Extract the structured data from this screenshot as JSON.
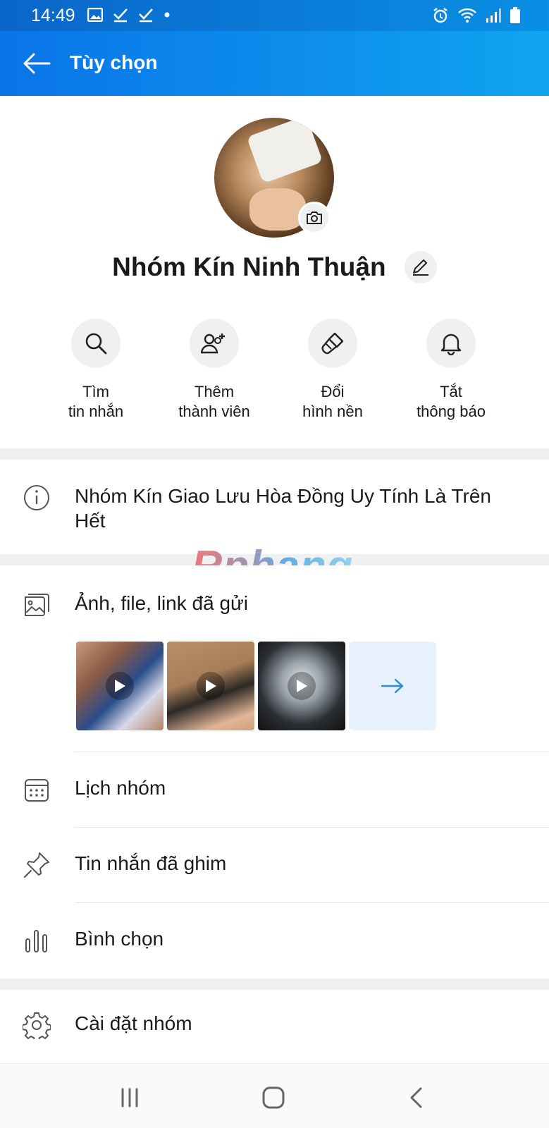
{
  "status_bar": {
    "time": "14:49",
    "left_icons": [
      "image-icon",
      "check-icon",
      "check-icon",
      "dot-icon"
    ],
    "right_icons": [
      "alarm-icon",
      "wifi-icon",
      "signal-icon",
      "battery-icon"
    ]
  },
  "app_bar": {
    "title": "Tùy chọn",
    "back_icon": "arrow-left-icon"
  },
  "profile": {
    "group_name": "Nhóm Kín Ninh Thuận",
    "camera_icon": "camera-icon",
    "edit_icon": "pencil-icon"
  },
  "actions": [
    {
      "icon": "search-icon",
      "label": "Tìm\ntin nhắn"
    },
    {
      "icon": "add-user-icon",
      "label": "Thêm\nthành viên"
    },
    {
      "icon": "brush-icon",
      "label": "Đổi\nhình nền"
    },
    {
      "icon": "bell-icon",
      "label": "Tắt\nthông báo"
    }
  ],
  "description": {
    "icon": "info-icon",
    "text": "Nhóm Kín Giao Lưu Hòa Đồng Uy Tính Là Trên Hết"
  },
  "watermark": "Rphang",
  "media": {
    "icon": "gallery-icon",
    "label": "Ảnh, file, link đã gửi",
    "thumbs": [
      "video-thumbnail",
      "video-thumbnail",
      "video-thumbnail"
    ],
    "more_icon": "arrow-right-icon"
  },
  "menu": [
    {
      "icon": "calendar-icon",
      "label": "Lịch nhóm"
    },
    {
      "icon": "pin-icon",
      "label": "Tin nhắn đã ghim"
    },
    {
      "icon": "poll-icon",
      "label": "Bình chọn"
    }
  ],
  "settings": {
    "icon": "gear-icon",
    "label": "Cài đặt nhóm"
  },
  "nav_bar": [
    "recent-apps-icon",
    "home-icon",
    "back-icon"
  ],
  "colors": {
    "accent": "#0a74e8",
    "accent_light": "#10a4ef",
    "arrow_blue": "#2a8ed8"
  }
}
